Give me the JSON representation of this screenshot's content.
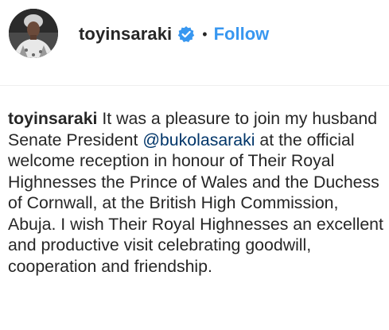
{
  "post_header": {
    "username": "toyinsaraki",
    "separator": "•",
    "follow_label": "Follow",
    "verified_icon": "verified-badge-icon",
    "colors": {
      "follow": "#3897f0",
      "verified": "#3897f0",
      "mention": "#003569"
    }
  },
  "caption": {
    "username": "toyinsaraki",
    "text_before_mention": " It was a pleasure to join my husband Senate President ",
    "mention": "@bukolasaraki",
    "text_after_mention": " at the official welcome reception in honour of Their Royal Highnesses the Prince of Wales and the Duchess of Cornwall, at the British High Commission, Abuja. I wish Their Royal Highnesses an excellent and productive visit celebrating goodwill, cooperation and friendship."
  }
}
